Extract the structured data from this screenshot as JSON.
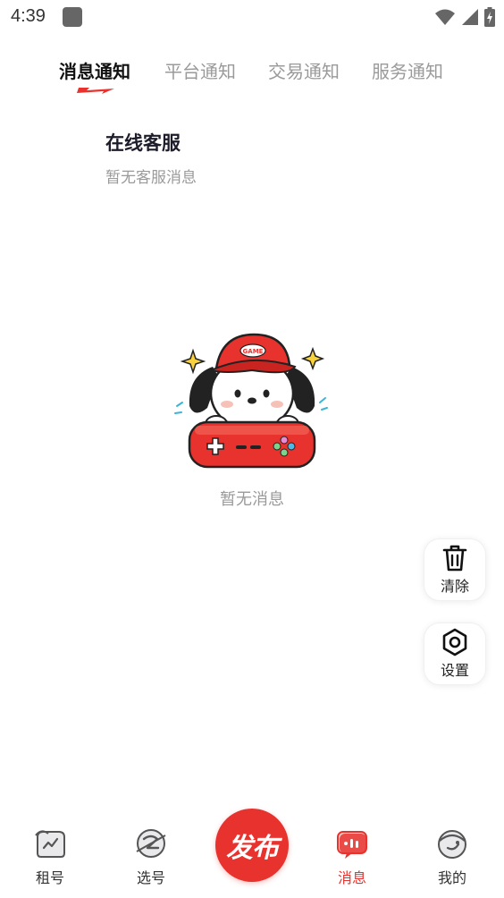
{
  "status_bar": {
    "time": "4:39"
  },
  "tabs": [
    {
      "label": "消息通知",
      "active": true
    },
    {
      "label": "平台通知",
      "active": false
    },
    {
      "label": "交易通知",
      "active": false
    },
    {
      "label": "服务通知",
      "active": false
    }
  ],
  "support": {
    "title": "在线客服",
    "subtitle": "暂无客服消息"
  },
  "empty_state": {
    "text": "暂无消息",
    "illustration_badge": "GAME"
  },
  "floating": {
    "clear": {
      "label": "清除",
      "icon": "trash-icon"
    },
    "settings": {
      "label": "设置",
      "icon": "hexagon-settings-icon"
    }
  },
  "bottom_nav": {
    "items": [
      {
        "label": "租号",
        "icon": "rent-icon"
      },
      {
        "label": "选号",
        "icon": "select-icon"
      },
      {
        "label": "消息",
        "icon": "message-icon",
        "active": true
      },
      {
        "label": "我的",
        "icon": "profile-icon"
      }
    ],
    "publish_label": "发布"
  },
  "colors": {
    "accent": "#e8322e",
    "text_primary": "#1c1c2a",
    "text_muted": "#9a9a9a"
  }
}
